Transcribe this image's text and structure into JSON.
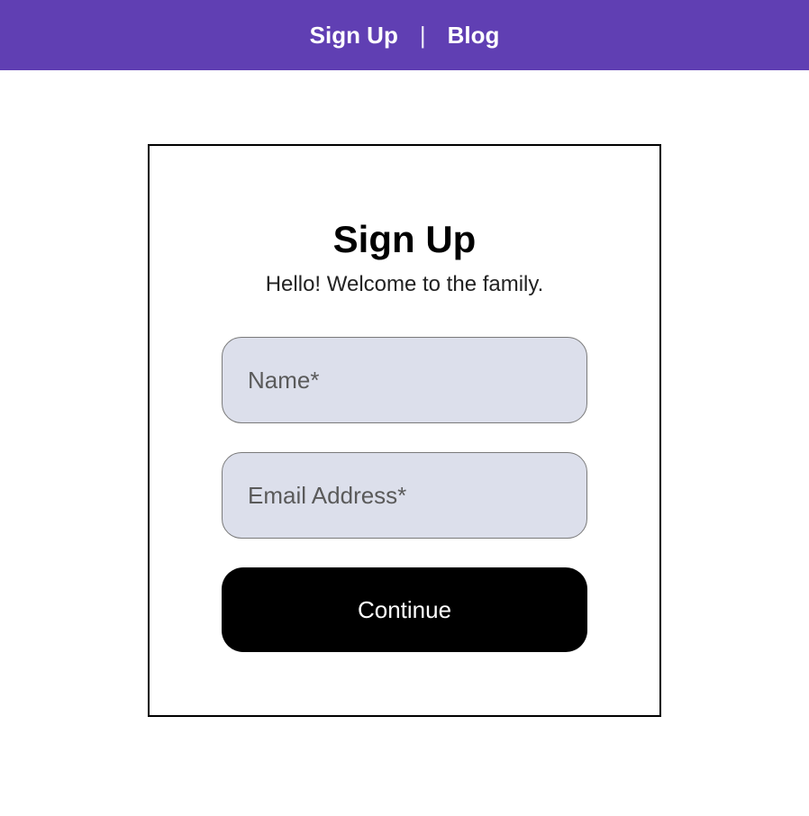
{
  "nav": {
    "signup_label": "Sign Up",
    "divider": "|",
    "blog_label": "Blog"
  },
  "form": {
    "title": "Sign Up",
    "subtitle": "Hello! Welcome to the family.",
    "name_placeholder": "Name*",
    "name_value": "",
    "email_placeholder": "Email Address*",
    "email_value": "",
    "continue_label": "Continue"
  },
  "colors": {
    "brand": "#603fb3",
    "input_bg": "#dcdfeb",
    "button_bg": "#000000"
  }
}
